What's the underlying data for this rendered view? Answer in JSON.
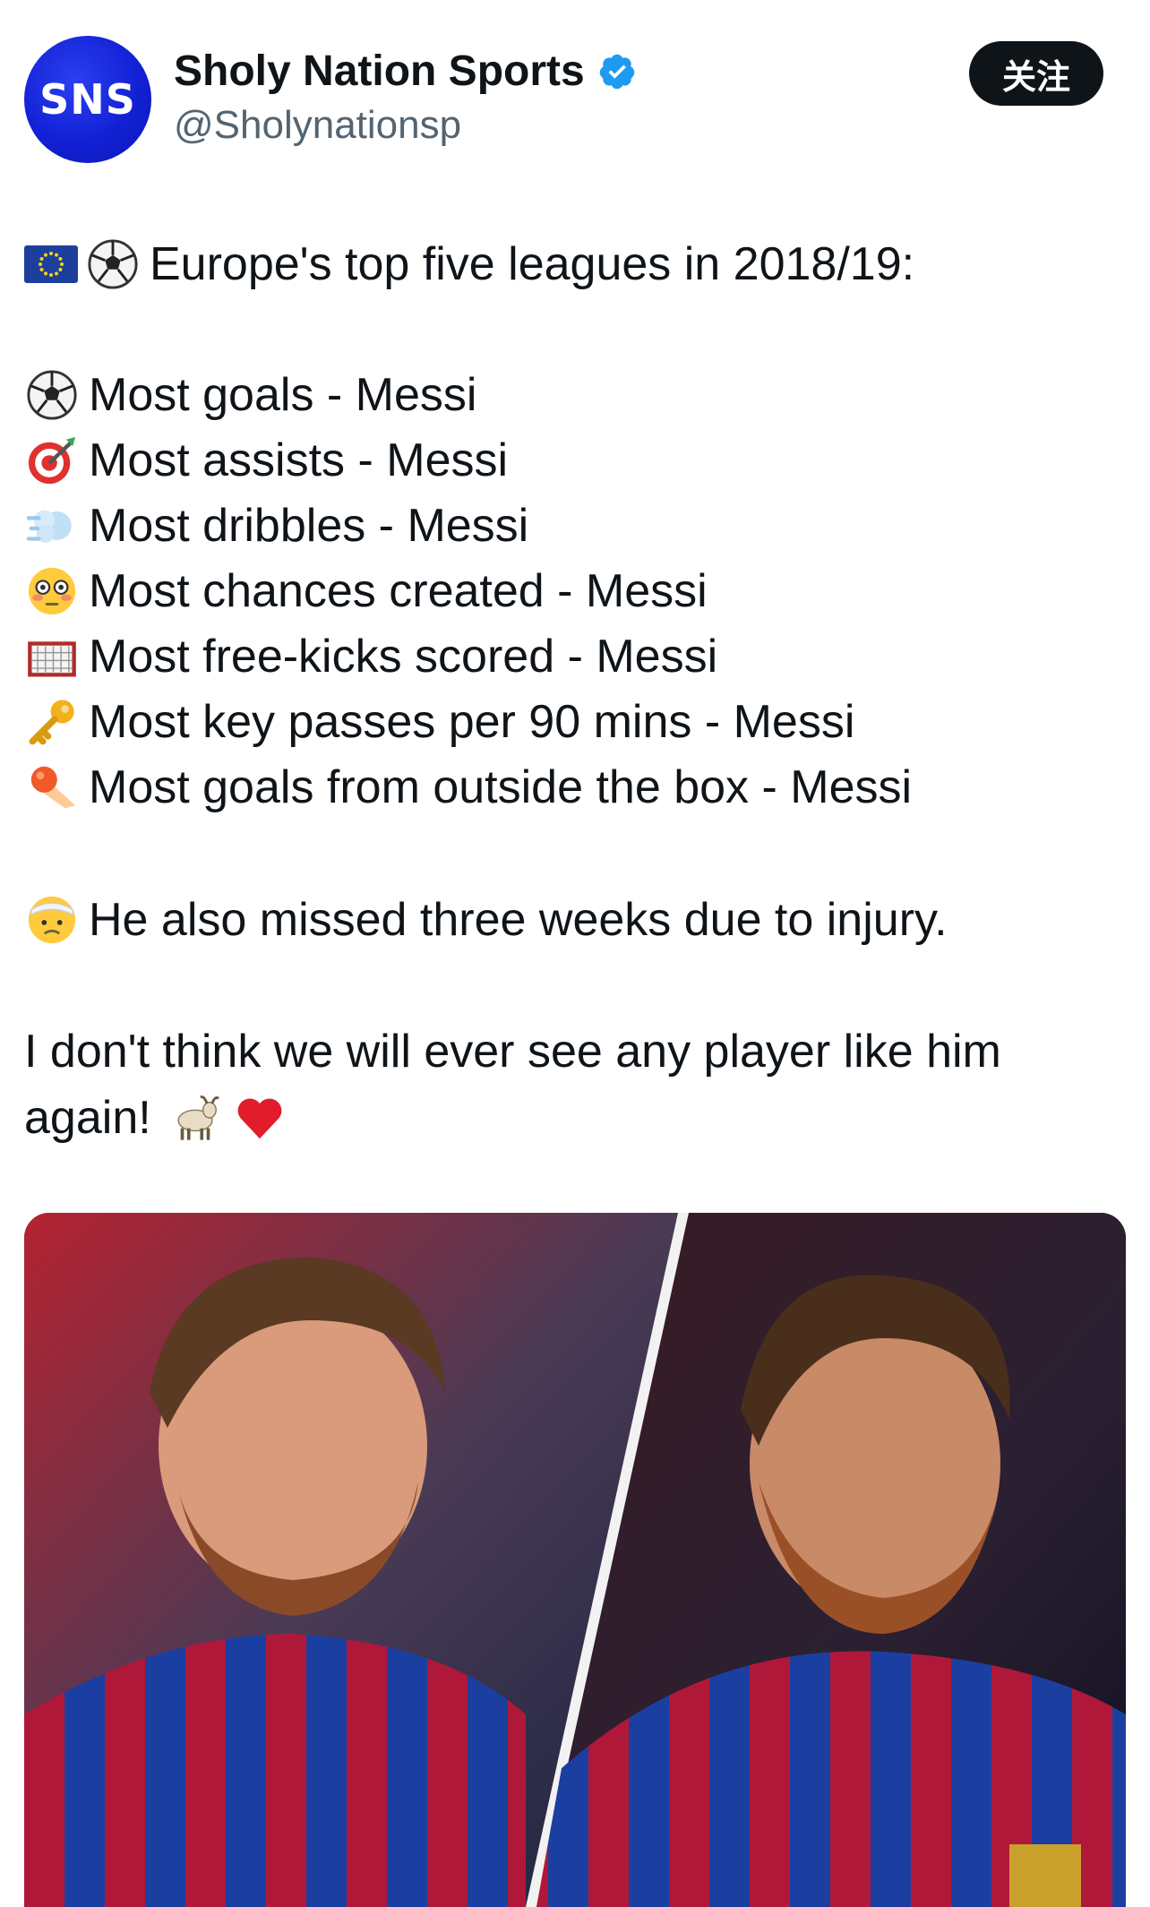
{
  "author": {
    "avatar_text": "SNS",
    "display_name": "Sholy Nation Sports",
    "handle": "@Sholynationsp",
    "verified": true,
    "follow_label": "关注"
  },
  "tweet": {
    "intro": "Europe's top five leagues in 2018/19:",
    "stats": [
      {
        "icon": "soccer-ball-icon",
        "text": "Most goals - Messi"
      },
      {
        "icon": "dart-target-icon",
        "text": "Most assists - Messi"
      },
      {
        "icon": "dash-cloud-icon",
        "text": "Most dribbles - Messi"
      },
      {
        "icon": "flushed-face-icon",
        "text": "Most chances created - Messi"
      },
      {
        "icon": "goal-net-icon",
        "text": "Most free-kicks scored - Messi"
      },
      {
        "icon": "key-icon",
        "text": "Most key passes per 90 mins - Messi"
      },
      {
        "icon": "comet-icon",
        "text": "Most goals from outside the box - Messi"
      }
    ],
    "injury_note": "He also missed three weeks due to injury.",
    "closing_line1": "I don't think we will ever see any player like him",
    "closing_line2": "again!"
  },
  "colors": {
    "verified_blue": "#1d9bf0",
    "avatar_blue": "#1321d6",
    "text": "#0f1419",
    "muted": "#536471"
  }
}
